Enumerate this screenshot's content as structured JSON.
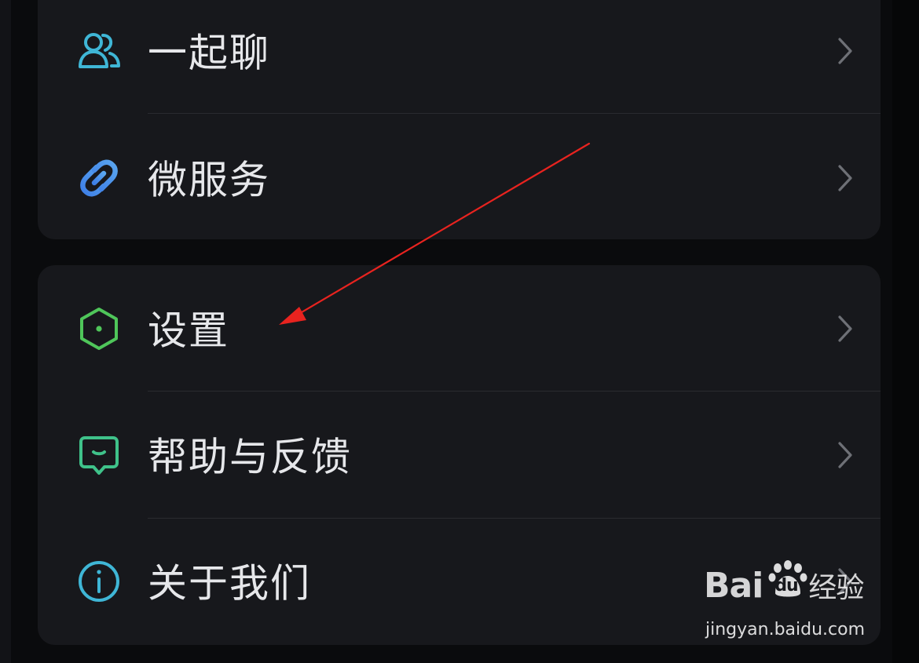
{
  "menu_groups": [
    {
      "items": [
        {
          "label": "一起聊",
          "icon": "group-chat-icon",
          "color": "#3fb6d6"
        },
        {
          "label": "微服务",
          "icon": "link-icon",
          "color": "#4b8fea"
        }
      ]
    },
    {
      "items": [
        {
          "label": "设置",
          "icon": "hexagon-settings-icon",
          "color": "#4fc65a"
        },
        {
          "label": "帮助与反馈",
          "icon": "feedback-icon",
          "color": "#3fc28a"
        },
        {
          "label": "关于我们",
          "icon": "info-icon",
          "color": "#3fb6d6"
        }
      ]
    }
  ],
  "annotation": {
    "type": "red-arrow",
    "color": "#e8231f",
    "points_to": "设置"
  },
  "watermark": {
    "logo": "Bai",
    "logo_suffix": "du",
    "logo_cn": "经验",
    "url": "jingyan.baidu.com"
  },
  "colors": {
    "background": "#0a0b0d",
    "card": "#17181c",
    "text": "#e6e7ea",
    "chevron": "#6e7076"
  }
}
